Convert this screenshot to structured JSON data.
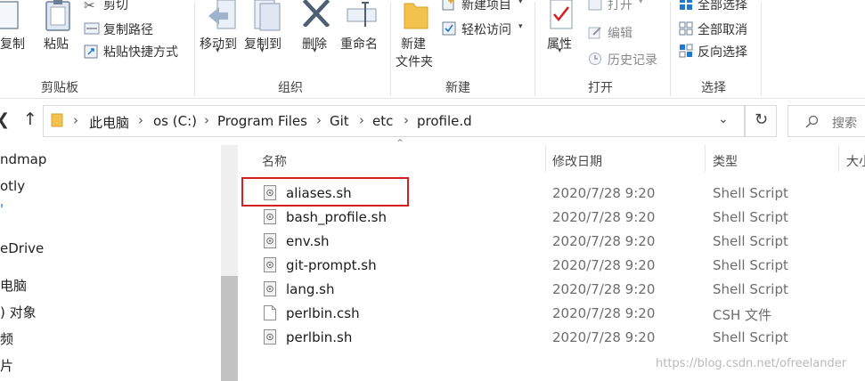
{
  "ribbon": {
    "clipboard": {
      "copy_label": "复制",
      "paste_label": "粘贴",
      "cut_label": "剪切",
      "copy_path_label": "复制路径",
      "paste_shortcut_label": "粘贴快捷方式",
      "group_label": "剪贴板"
    },
    "organize": {
      "move_to_label": "移动到",
      "copy_to_label": "复制到",
      "delete_label": "删除",
      "rename_label": "重命名",
      "group_label": "组织"
    },
    "new": {
      "new_folder_label_line1": "新建",
      "new_folder_label_line2": "文件夹",
      "new_item_label": "新建项目",
      "easy_access_label": "轻松访问",
      "group_label": "新建"
    },
    "open": {
      "properties_label": "属性",
      "open_label": "打开",
      "edit_label": "编辑",
      "history_label": "历史记录",
      "group_label": "打开"
    },
    "select": {
      "select_all_label": "全部选择",
      "select_none_label": "全部取消",
      "invert_label": "反向选择",
      "group_label": "选择"
    }
  },
  "address": {
    "crumbs": [
      "此电脑",
      "os (C:)",
      "Program Files",
      "Git",
      "etc",
      "profile.d"
    ],
    "search_placeholder": "搜索"
  },
  "nav": {
    "items": [
      "ndmap",
      "otly",
      "'",
      "eDrive",
      "电脑",
      ") 对象",
      "频",
      "片"
    ]
  },
  "list": {
    "headers": {
      "name": "名称",
      "date": "修改日期",
      "type": "类型",
      "size": "大小"
    },
    "rows": [
      {
        "name": "aliases.sh",
        "date": "2020/7/28 9:20",
        "type": "Shell Script"
      },
      {
        "name": "bash_profile.sh",
        "date": "2020/7/28 9:20",
        "type": "Shell Script"
      },
      {
        "name": "env.sh",
        "date": "2020/7/28 9:20",
        "type": "Shell Script"
      },
      {
        "name": "git-prompt.sh",
        "date": "2020/7/28 9:20",
        "type": "Shell Script"
      },
      {
        "name": "lang.sh",
        "date": "2020/7/28 9:20",
        "type": "Shell Script"
      },
      {
        "name": "perlbin.csh",
        "date": "2020/7/28 9:20",
        "type": "CSH 文件"
      },
      {
        "name": "perlbin.sh",
        "date": "2020/7/28 9:20",
        "type": "Shell Script"
      }
    ]
  },
  "watermark": "https://blog.csdn.net/ofreelander",
  "colors": {
    "accent": "#1e78d4",
    "highlight": "#d32020",
    "folder": "#e8b33a"
  }
}
